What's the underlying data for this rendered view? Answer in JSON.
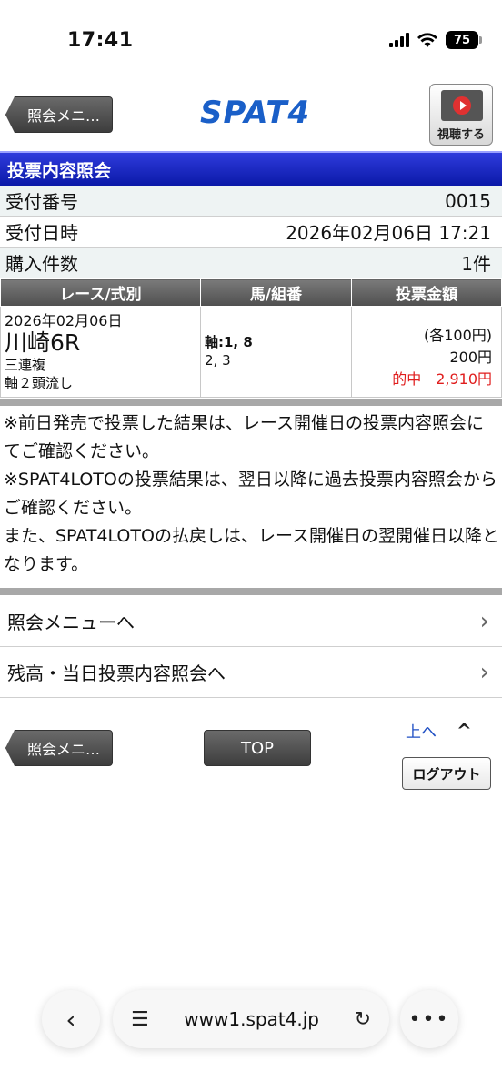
{
  "status": {
    "time": "17:41",
    "battery": "75"
  },
  "header": {
    "back_label": "照会メニ…",
    "logo": "SPAT4",
    "watch_label": "視聴する"
  },
  "title": "投票内容照会",
  "info": [
    {
      "label": "受付番号",
      "value": "0015"
    },
    {
      "label": "受付日時",
      "value": "2026年02月06日 17:21"
    },
    {
      "label": "購入件数",
      "value": "1件"
    }
  ],
  "table": {
    "headers": [
      "レース/式別",
      "馬/組番",
      "投票金額"
    ],
    "row": {
      "date": "2026年02月06日",
      "race": "川崎6R",
      "bet_type": "三連複",
      "method": "軸２頭流し",
      "axis": "軸:1, 8",
      "partners": "2, 3",
      "each": "(各100円)",
      "total": "200円",
      "hit": "的中　2,910円"
    }
  },
  "notes": [
    "※前日発売で投票した結果は、レース開催日の投票内容照会にてご確認ください。",
    "※SPAT4LOTOの投票結果は、翌日以降に過去投票内容照会からご確認ください。",
    "また、SPAT4LOTOの払戻しは、レース開催日の翌開催日以降となります。"
  ],
  "menu": [
    {
      "label": "照会メニューへ"
    },
    {
      "label": "残高・当日投票内容照会へ"
    }
  ],
  "footer": {
    "back_label": "照会メニ…",
    "top_label": "TOP",
    "up_label": "上へ",
    "logout_label": "ログアウト"
  },
  "browser": {
    "url": "www1.spat4.jp"
  },
  "colors": {
    "title_bar": "#0b19a8",
    "hit": "#e01e1e",
    "link": "#1f4fc4"
  }
}
